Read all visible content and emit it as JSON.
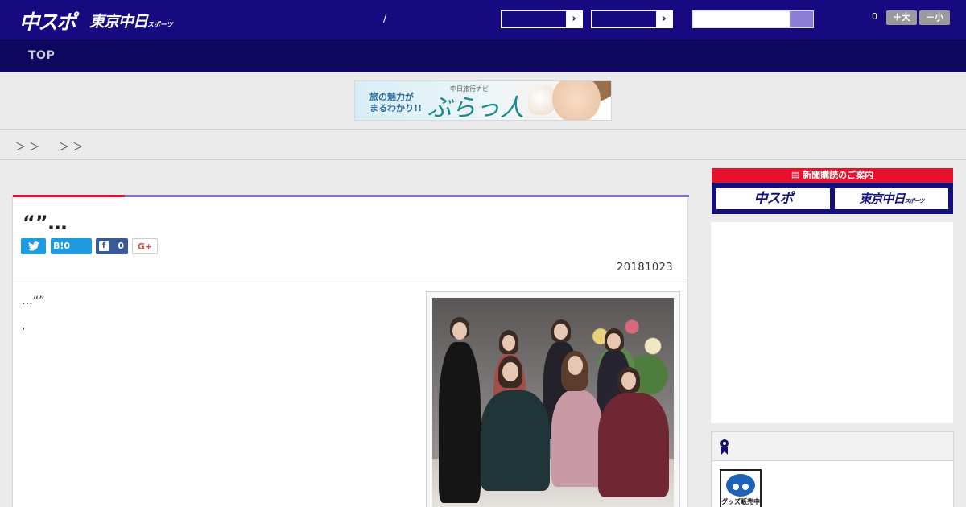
{
  "header": {
    "logo_primary": "中スポ",
    "logo_secondary": "東京中日",
    "logo_secondary_sub": "スポーツ",
    "separator": "/",
    "select1_arrow": "›",
    "select2_arrow": "›",
    "search_placeholder": "",
    "font_size_value": "0",
    "font_bigger": "＋大",
    "font_smaller": "－小"
  },
  "nav": {
    "top_label": "TOP"
  },
  "banner": {
    "line1": "旅の魅力が",
    "line2": "まるわかり!!",
    "small": "中日旅行ナビ",
    "brand": "ぶらっ人"
  },
  "breadcrumb": {
    "sep1": "＞ ＞",
    "sep2": "＞ ＞"
  },
  "article": {
    "title": "“”…",
    "share": {
      "twitter": "",
      "hatena_label": "B!",
      "hatena_count": "0",
      "facebook_icon": "f",
      "facebook_count": "0",
      "gplus": "G+"
    },
    "date": "20181023",
    "body_line1": "…“”",
    "body_line2": ","
  },
  "sidebar": {
    "subscription_header": "新聞購読のご案内",
    "sub_btn_1": "中スポ",
    "sub_btn_2": "東京中日",
    "sub_btn_2_small": "スポーツ",
    "goods_label": "グッズ販売中"
  },
  "colors": {
    "header_bg": "#170a80",
    "nav_bg": "#0f0660",
    "accent_red": "#e8112d",
    "accent_purple": "#7f72c9",
    "twitter": "#1e9be0",
    "facebook": "#3b5998"
  },
  "icons": [
    "twitter-icon",
    "hatena-icon",
    "facebook-icon",
    "google-plus-icon",
    "search-icon",
    "ribbon-icon",
    "newspaper-icon"
  ]
}
